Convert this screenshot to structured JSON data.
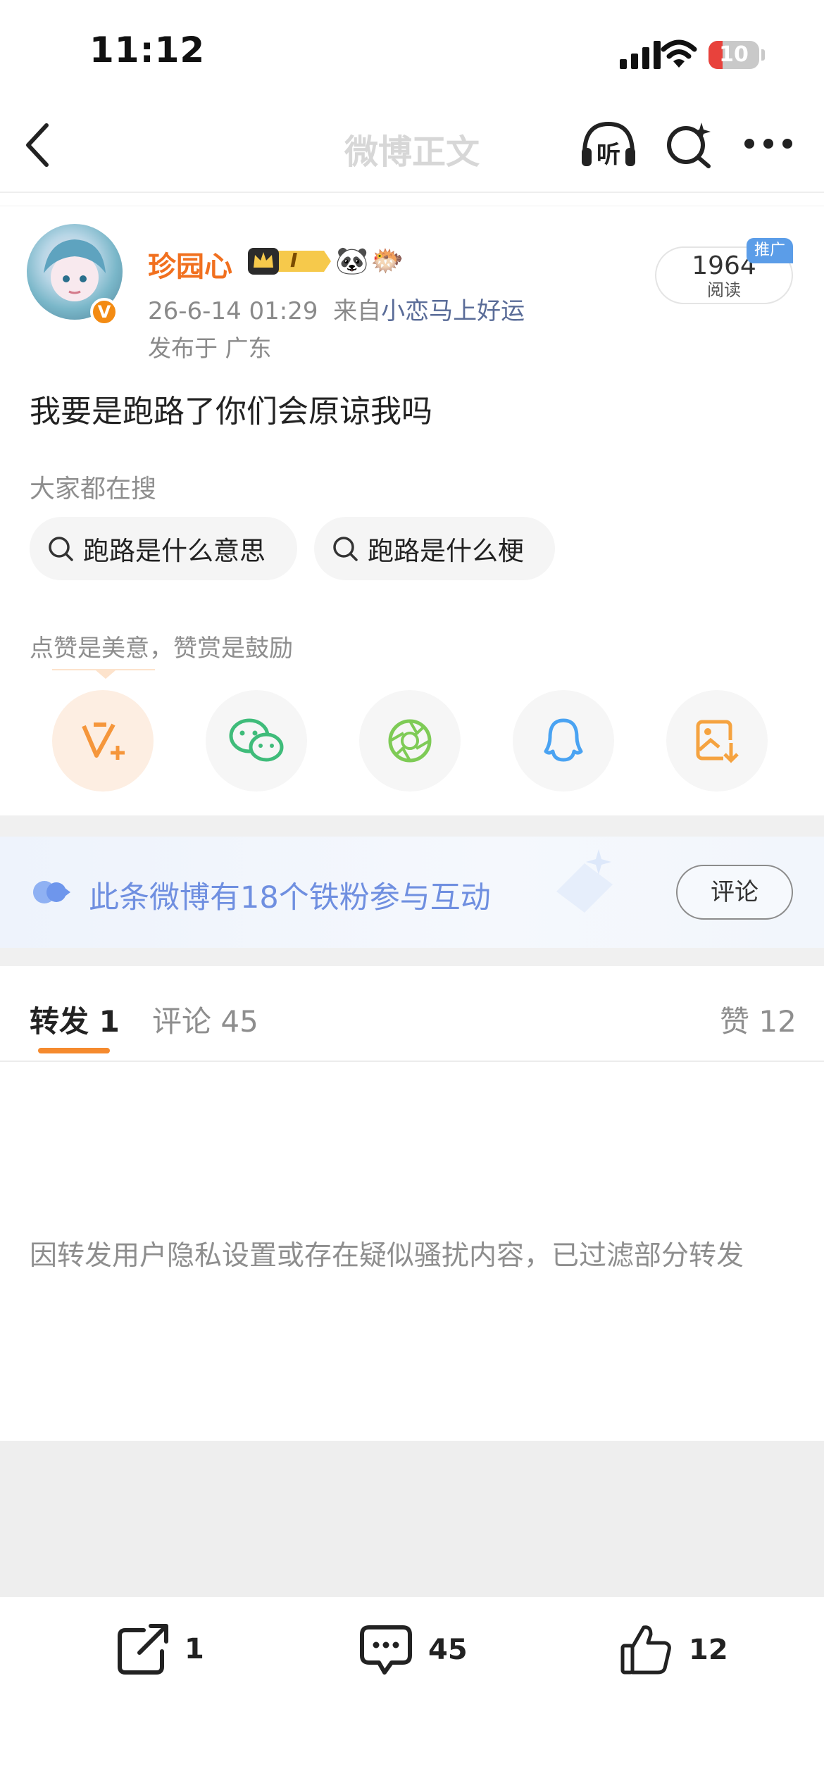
{
  "status_bar": {
    "time": "11:12",
    "battery": "10"
  },
  "nav": {
    "title": "微博正文",
    "listen_label": "听"
  },
  "post": {
    "author": "珍园心",
    "vip_level": "I",
    "time": "26-6-14 01:29",
    "source_prefix": "来自",
    "source": "小恋马上好运",
    "location": "发布于 广东",
    "reads": "1964",
    "reads_label": "阅读",
    "promo_tag": "推广",
    "verify_mark": "V",
    "content": "我要是跑路了你们会原谅我吗"
  },
  "hot_search": {
    "label": "大家都在搜",
    "chips": [
      "跑路是什么意思",
      "跑路是什么梗"
    ]
  },
  "reward": {
    "label": "点赞是美意，赞赏是鼓励"
  },
  "fans_banner": {
    "text": "此条微博有18个铁粉参与互动",
    "button": "评论"
  },
  "tabs": {
    "repost": "转发 1",
    "comment": "评论 45",
    "like": "赞 12"
  },
  "filter_note": "因转发用户隐私设置或存在疑似骚扰内容，已过滤部分转发",
  "bottom_bar": {
    "repost": "1",
    "comment": "45",
    "like": "12"
  }
}
